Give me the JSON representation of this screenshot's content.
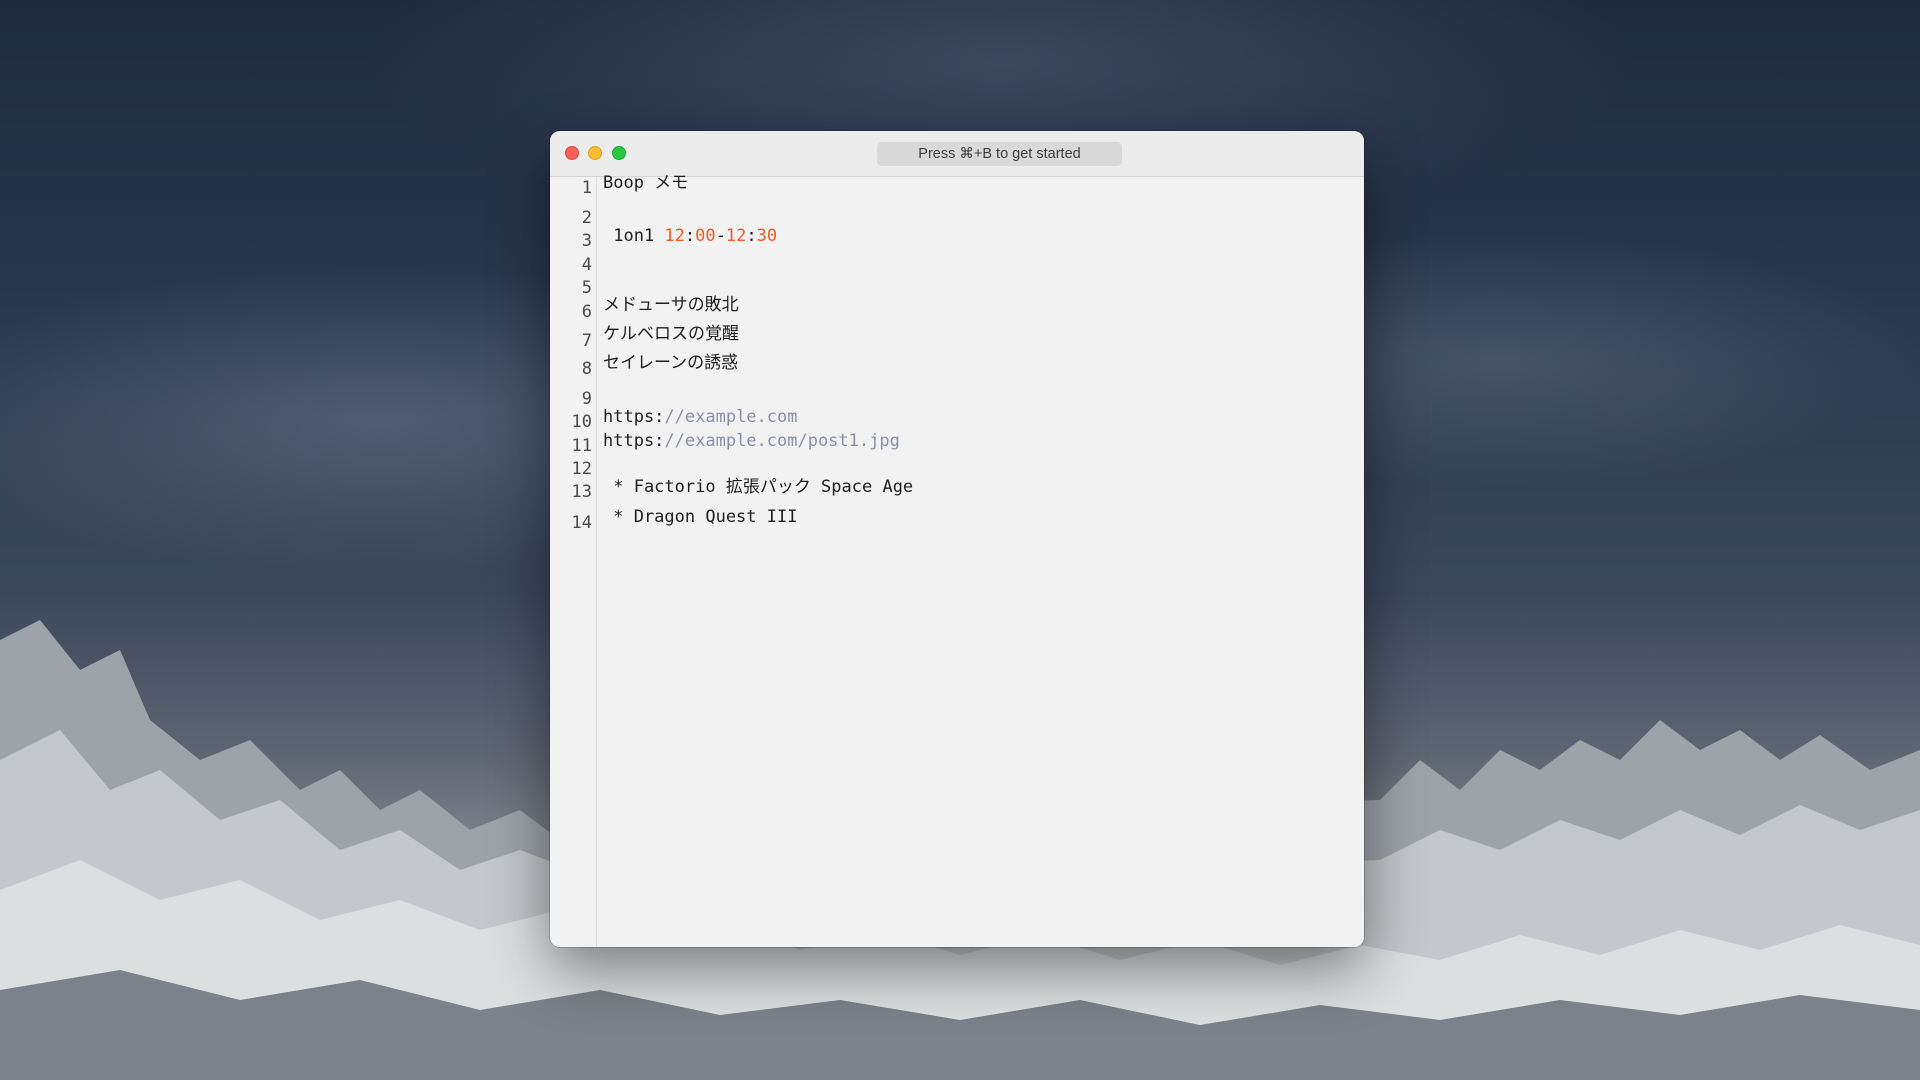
{
  "window": {
    "search_hint": "Press ⌘+B to get started"
  },
  "editor": {
    "line_numbers": [
      "1",
      "2",
      "3",
      "4",
      "5",
      "6",
      "7",
      "8",
      "9",
      "10",
      "11",
      "12",
      "13",
      "14"
    ],
    "lines": {
      "l1": "Boop メモ",
      "l3_prefix": " 1on1 ",
      "l3_h1": "12",
      "l3_c1": ":",
      "l3_m1": "00",
      "l3_dash": "-",
      "l3_h2": "12",
      "l3_c2": ":",
      "l3_m2": "30",
      "l6": "メドューサの敗北",
      "l7": "ケルベロスの覚醒",
      "l8": "セイレーンの誘惑",
      "l10_scheme": "https:",
      "l10_rest": "//example.com",
      "l11_scheme": "https:",
      "l11_rest": "//example.com/post1.jpg",
      "l13": " * Factorio 拡張パック Space Age",
      "l14": " * Dragon Quest III"
    }
  },
  "colors": {
    "number_highlight": "#ee5a2a",
    "url_highlight": "#8a90a8",
    "close": "#fe5f57",
    "minimize": "#febc2e",
    "zoom": "#28c840"
  }
}
